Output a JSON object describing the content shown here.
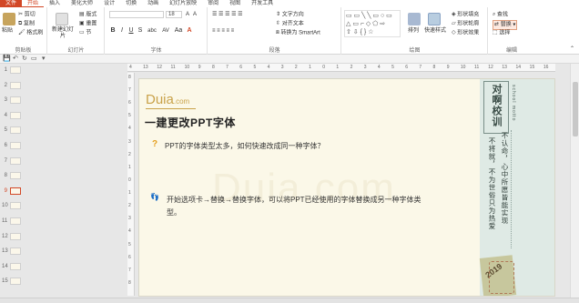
{
  "tabs": [
    "文件",
    "开始",
    "插入",
    "美化大师",
    "设计",
    "切换",
    "动画",
    "幻灯片放映",
    "审阅",
    "视图",
    "开发工具"
  ],
  "active_tab_index": 1,
  "ribbon": {
    "clipboard": {
      "paste": "粘贴",
      "cut": "剪切",
      "copy": "复制",
      "format_painter": "格式刷",
      "label": "剪贴板"
    },
    "slides": {
      "new_slide": "新建幻灯片",
      "layout": "版式",
      "reset": "重置",
      "section": "节",
      "label": "幻灯片"
    },
    "font": {
      "font_name": "",
      "font_size": "18",
      "bold": "B",
      "italic": "I",
      "underline": "U",
      "strike": "S",
      "shadow": "abc",
      "spacing": "AV",
      "case": "Aa",
      "color": "A",
      "label": "字体"
    },
    "paragraph": {
      "text_direction": "文字方向",
      "align_text": "对齐文本",
      "smartart": "转换为 SmartArt",
      "label": "段落"
    },
    "drawing": {
      "arrange": "排列",
      "quick_styles": "快速样式",
      "shape_fill": "形状填充",
      "shape_outline": "形状轮廓",
      "shape_effects": "形状效果",
      "label": "绘图"
    },
    "editing": {
      "find": "查找",
      "replace": "替换",
      "select": "选择",
      "label": "编辑"
    }
  },
  "ruler_h": [
    "4",
    "13",
    "12",
    "11",
    "10",
    "9",
    "8",
    "7",
    "6",
    "5",
    "4",
    "3",
    "2",
    "1",
    "0",
    "1",
    "2",
    "3",
    "4",
    "5",
    "6",
    "7",
    "8",
    "9",
    "10",
    "11",
    "12",
    "13",
    "14",
    "15",
    "16"
  ],
  "ruler_v": [
    "8",
    "7",
    "6",
    "5",
    "4",
    "3",
    "2",
    "1",
    "0",
    "1",
    "2",
    "3",
    "4",
    "5",
    "6",
    "7",
    "8"
  ],
  "thumbnails": [
    "1",
    "2",
    "3",
    "4",
    "5",
    "6",
    "7",
    "8",
    "9",
    "10",
    "11",
    "12",
    "13",
    "14",
    "15"
  ],
  "selected_thumbnail": "9",
  "slide": {
    "logo": "Duia",
    "logo_suffix": ".com",
    "title": "一建更改PPT字体",
    "question_icon": "?",
    "question": "PPT的字体类型太多，如何快速改成同一种字体？",
    "answer_icon": "👣",
    "answer_line1": "开始选项卡→替换→替换字体，可以将PPT已经使用的字体替换成另一种字体类",
    "answer_line2": "型。",
    "watermark": "Duia.com",
    "banner": {
      "motto_main": "对啊校训",
      "motto_small": "school motto",
      "line1": "不认命，心中所愿皆能实现",
      "line2": "不将就，不为世俗只为热爱",
      "year": "2019"
    }
  },
  "colors": {
    "accent": "#d24726",
    "slide_bg": "#fbf8e8",
    "logo": "#c9a24a",
    "banner_bg": "#dfeae5",
    "bullet": "#e5a021"
  }
}
